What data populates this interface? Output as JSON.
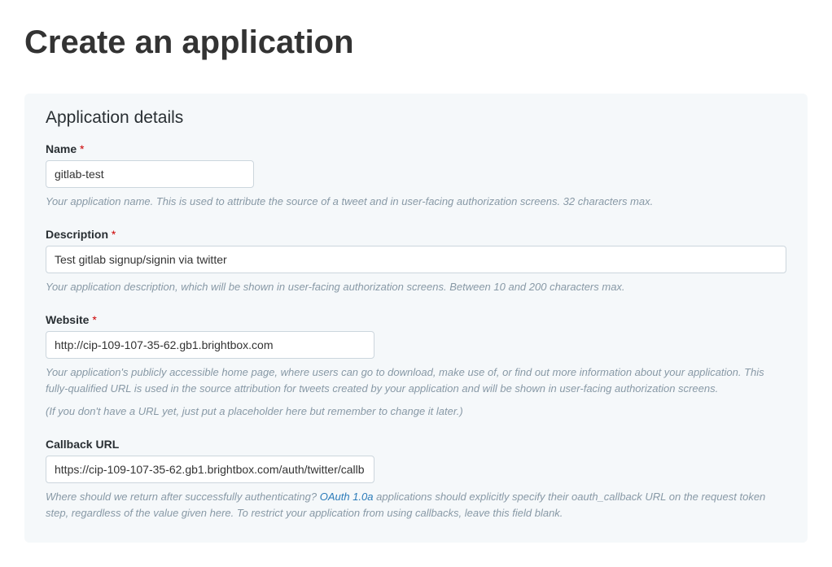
{
  "page_title": "Create an application",
  "panel_heading": "Application details",
  "fields": {
    "name": {
      "label": "Name",
      "value": "gitlab-test",
      "help": "Your application name. This is used to attribute the source of a tweet and in user-facing authorization screens. 32 characters max."
    },
    "description": {
      "label": "Description",
      "value": "Test gitlab signup/signin via twitter",
      "help": "Your application description, which will be shown in user-facing authorization screens. Between 10 and 200 characters max."
    },
    "website": {
      "label": "Website",
      "value": "http://cip-109-107-35-62.gb1.brightbox.com",
      "help_line1": "Your application's publicly accessible home page, where users can go to download, make use of, or find out more information about your application. This fully-qualified URL is used in the source attribution for tweets created by your application and will be shown in user-facing authorization screens.",
      "help_line2": "(If you don't have a URL yet, just put a placeholder here but remember to change it later.)"
    },
    "callback": {
      "label": "Callback URL",
      "value": "https://cip-109-107-35-62.gb1.brightbox.com/auth/twitter/callb",
      "help_prefix": "Where should we return after successfully authenticating? ",
      "oauth_link_text": "OAuth 1.0a",
      "help_suffix": " applications should explicitly specify their oauth_callback URL on the request token step, regardless of the value given here. To restrict your application from using callbacks, leave this field blank."
    }
  },
  "required_marker": "*"
}
